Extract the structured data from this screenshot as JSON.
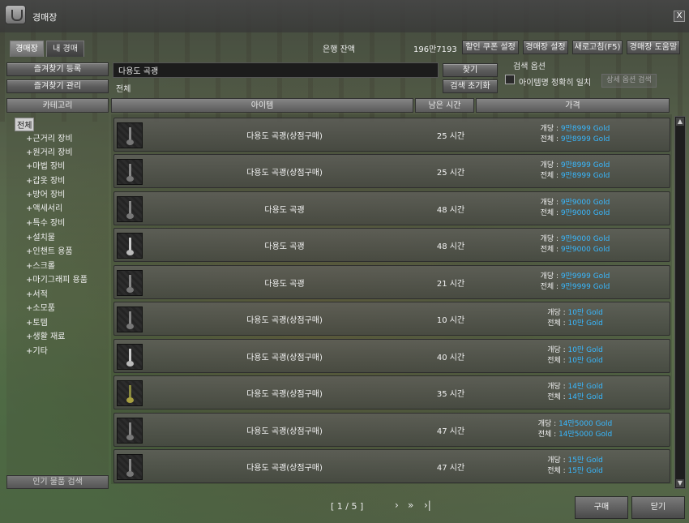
{
  "window": {
    "title": "경매장",
    "close_label": "X"
  },
  "tabs": [
    {
      "label": "경매장"
    },
    {
      "label": "내 경매"
    }
  ],
  "bank": {
    "label": "은행 잔액",
    "amount": "196만7193"
  },
  "top_buttons": {
    "discount_coupon": "할인 쿠폰 설정",
    "auction_settings": "경매장 설정",
    "refresh": "새로고침(F5)",
    "help": "경매장 도움말"
  },
  "favorites": {
    "register": "즐겨찾기 등록",
    "manage": "즐겨찾기 관리"
  },
  "search": {
    "value": "다용도 곡괭",
    "find_button": "찾기",
    "reset_button": "검색 초기화",
    "category_path": "전체",
    "options_title": "검색 옵션",
    "exact_match_label": "아이템명 정확히 일치",
    "detail_button": "상세 옵션 검색"
  },
  "columns": {
    "category": "카테고리",
    "item": "아이템",
    "time_left": "남은 시간",
    "price": "가격"
  },
  "categories": [
    {
      "label": "전체",
      "selected": true
    },
    {
      "label": "+근거리 장비"
    },
    {
      "label": "+원거리 장비"
    },
    {
      "label": "+마법 장비"
    },
    {
      "label": "+갑옷 장비"
    },
    {
      "label": "+방어 장비"
    },
    {
      "label": "+액세서리"
    },
    {
      "label": "+특수 장비"
    },
    {
      "label": "+설치물"
    },
    {
      "label": "+인챈트 용품"
    },
    {
      "label": "+스크롤"
    },
    {
      "label": "+마기그래피 용품"
    },
    {
      "label": "+서적"
    },
    {
      "label": "+소모품"
    },
    {
      "label": "+토템"
    },
    {
      "label": "+생활 재료"
    },
    {
      "label": "+기타"
    }
  ],
  "popular_search_label": "인기 물품 검색",
  "price_labels": {
    "each": "개당 : ",
    "total": "전체 : "
  },
  "items": [
    {
      "name": "다용도 곡괭(상점구매)",
      "time": "25 시간",
      "each": "9만8999 Gold",
      "total": "9만8999 Gold"
    },
    {
      "name": "다용도 곡괭(상점구매)",
      "time": "25 시간",
      "each": "9만8999 Gold",
      "total": "9만8999 Gold"
    },
    {
      "name": "다용도 곡괭",
      "time": "48 시간",
      "each": "9만9000 Gold",
      "total": "9만9000 Gold"
    },
    {
      "name": "다용도 곡괭",
      "time": "48 시간",
      "each": "9만9000 Gold",
      "total": "9만9000 Gold"
    },
    {
      "name": "다용도 곡괭",
      "time": "21 시간",
      "each": "9만9999 Gold",
      "total": "9만9999 Gold"
    },
    {
      "name": "다용도 곡괭(상점구매)",
      "time": "10 시간",
      "each": "10만 Gold",
      "total": "10만 Gold"
    },
    {
      "name": "다용도 곡괭(상점구매)",
      "time": "40 시간",
      "each": "10만 Gold",
      "total": "10만 Gold"
    },
    {
      "name": "다용도 곡괭(상점구매)",
      "time": "35 시간",
      "each": "14만 Gold",
      "total": "14만 Gold"
    },
    {
      "name": "다용도 곡괭(상점구매)",
      "time": "47 시간",
      "each": "14만5000 Gold",
      "total": "14만5000 Gold"
    },
    {
      "name": "다용도 곡괭(상점구매)",
      "time": "47 시간",
      "each": "15만 Gold",
      "total": "15만 Gold"
    }
  ],
  "pagination": {
    "text": "[ 1 / 5 ]",
    "next": "›",
    "next_fast": "»",
    "last": "›|"
  },
  "footer": {
    "buy_button": "구매",
    "close_button": "닫기"
  },
  "colors": {
    "price_value": "#38b8ff",
    "panel": "#5b5b5b"
  }
}
